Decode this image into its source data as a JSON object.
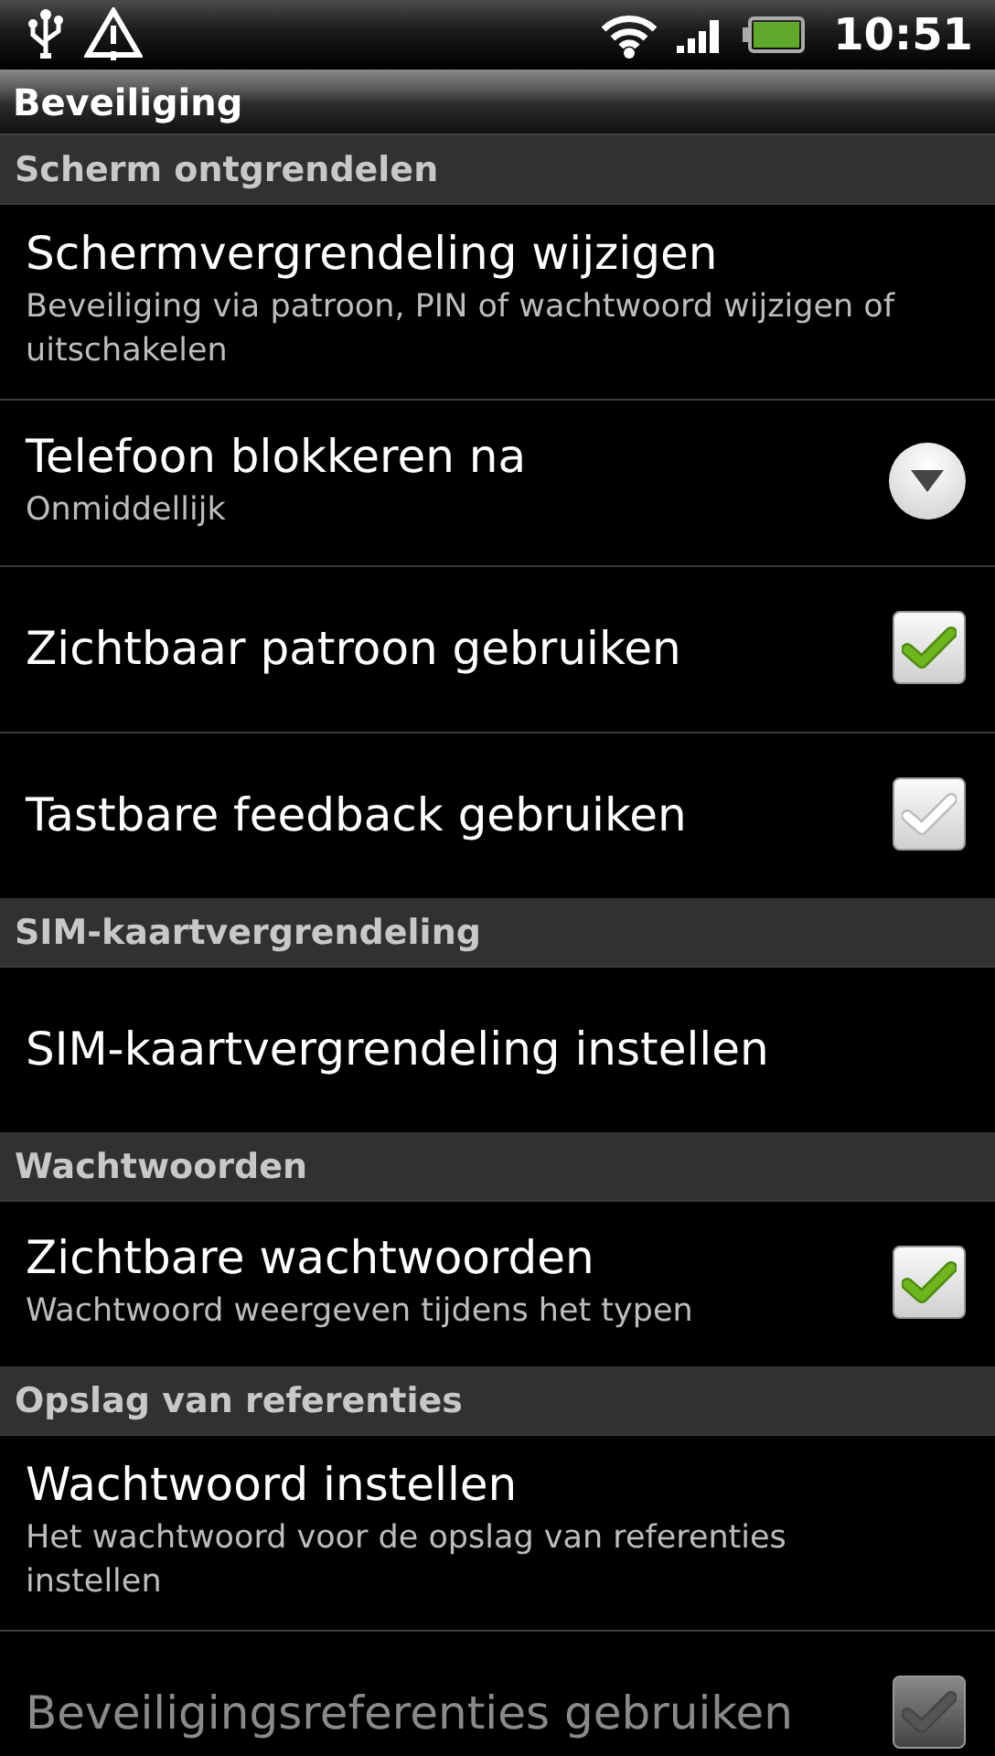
{
  "status_bar": {
    "time": "10:51"
  },
  "title": "Beveiliging",
  "sections": [
    {
      "header": "Scherm ontgrendelen",
      "items": [
        {
          "title": "Schermvergrendeling wijzigen",
          "summary": "Beveiliging via patroon, PIN of wachtwoord wijzigen of uitschakelen",
          "kind": "plain",
          "disabled": false
        },
        {
          "title": "Telefoon blokkeren na",
          "summary": "Onmiddellijk",
          "kind": "dropdown",
          "disabled": false
        },
        {
          "title": "Zichtbaar patroon gebruiken",
          "kind": "checkbox",
          "checked": true,
          "disabled": false
        },
        {
          "title": "Tastbare feedback gebruiken",
          "kind": "checkbox",
          "checked": false,
          "disabled": false
        }
      ]
    },
    {
      "header": "SIM-kaartvergrendeling",
      "items": [
        {
          "title": "SIM-kaartvergrendeling instellen",
          "kind": "plain",
          "disabled": false
        }
      ]
    },
    {
      "header": "Wachtwoorden",
      "items": [
        {
          "title": "Zichtbare wachtwoorden",
          "summary": "Wachtwoord weergeven tijdens het typen",
          "kind": "checkbox",
          "checked": true,
          "disabled": false
        }
      ]
    },
    {
      "header": "Opslag van referenties",
      "items": [
        {
          "title": "Wachtwoord instellen",
          "summary": "Het wachtwoord voor de opslag van referenties instellen",
          "kind": "plain",
          "disabled": false
        },
        {
          "title": "Beveiligingsreferenties gebruiken",
          "kind": "checkbox",
          "checked": false,
          "disabled": true
        }
      ]
    }
  ]
}
